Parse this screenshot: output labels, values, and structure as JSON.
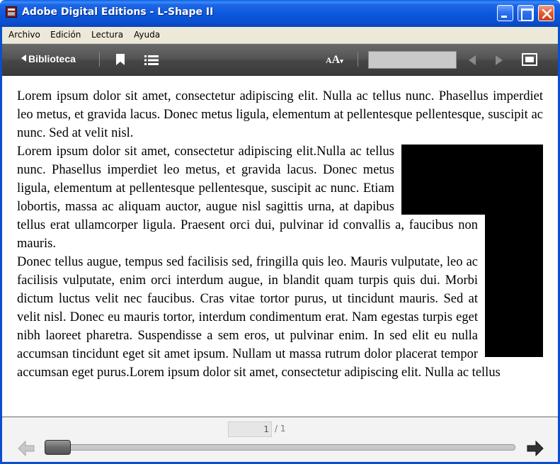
{
  "window": {
    "title": "Adobe Digital Editions - L-Shape II"
  },
  "menu": {
    "items": [
      {
        "label": "Archivo"
      },
      {
        "label": "Edición"
      },
      {
        "label": "Lectura"
      },
      {
        "label": "Ayuda"
      }
    ]
  },
  "toolbar": {
    "library_label": "Biblioteca",
    "font_size_small": "A",
    "font_size_big": "A",
    "search_value": "",
    "icons": [
      "back-triangle-icon",
      "bookmark-icon",
      "toc-list-icon",
      "font-size-icon",
      "prev-arrow-icon",
      "next-arrow-icon",
      "fullscreen-icon"
    ]
  },
  "content": {
    "paragraphs": [
      "Lorem ipsum dolor sit amet, consectetur adipiscing elit. Nulla ac tellus nunc. Phasellus imperdiet leo metus, et gravida lacus. Donec metus ligula, elementum at pellentesque pellentesque, suscipit ac nunc. Sed at velit nisl.",
      "Lorem ipsum dolor sit amet, consectetur adipiscing elit.Nulla ac tellus nunc. Phasellus imperdiet leo metus, et gravida lacus. Donec metus ligula, elementum at pellentesque pellentesque, suscipit ac nunc. Etiam lobortis, massa ac aliquam auctor, augue nisl sagittis urna, at dapibus tellus erat ullamcorper ligula. Praesent orci dui, pulvinar id convallis a, faucibus non mauris.",
      "Donec tellus augue, tempus sed facilisis sed, fringilla quis leo. Mauris vulputate, leo ac facilisis vulputate, enim orci interdum augue, in blandit quam turpis quis dui. Morbi dictum luctus velit nec faucibus. Cras vitae tortor purus, ut tincidunt mauris. Sed at velit nisl. Donec eu mauris tortor, interdum condimentum erat. Nam egestas turpis eget nibh laoreet pharetra. Suspendisse a sem eros, ut pulvinar enim. In sed elit eu nulla accumsan tincidunt eget sit amet ipsum. Nullam ut massa rutrum dolor placerat tempor accumsan eget purus.Lorem ipsum dolor sit amet, consectetur adipiscing elit. Nulla ac tellus"
    ],
    "shape_color": "#000000"
  },
  "navigation": {
    "current_page": "1",
    "total_pages": "/ 1",
    "progress_fraction": 0.0
  },
  "colors": {
    "titlebar": "#0b56dc",
    "toolbar": "#4a4a4a",
    "menubar": "#ece9d8"
  }
}
